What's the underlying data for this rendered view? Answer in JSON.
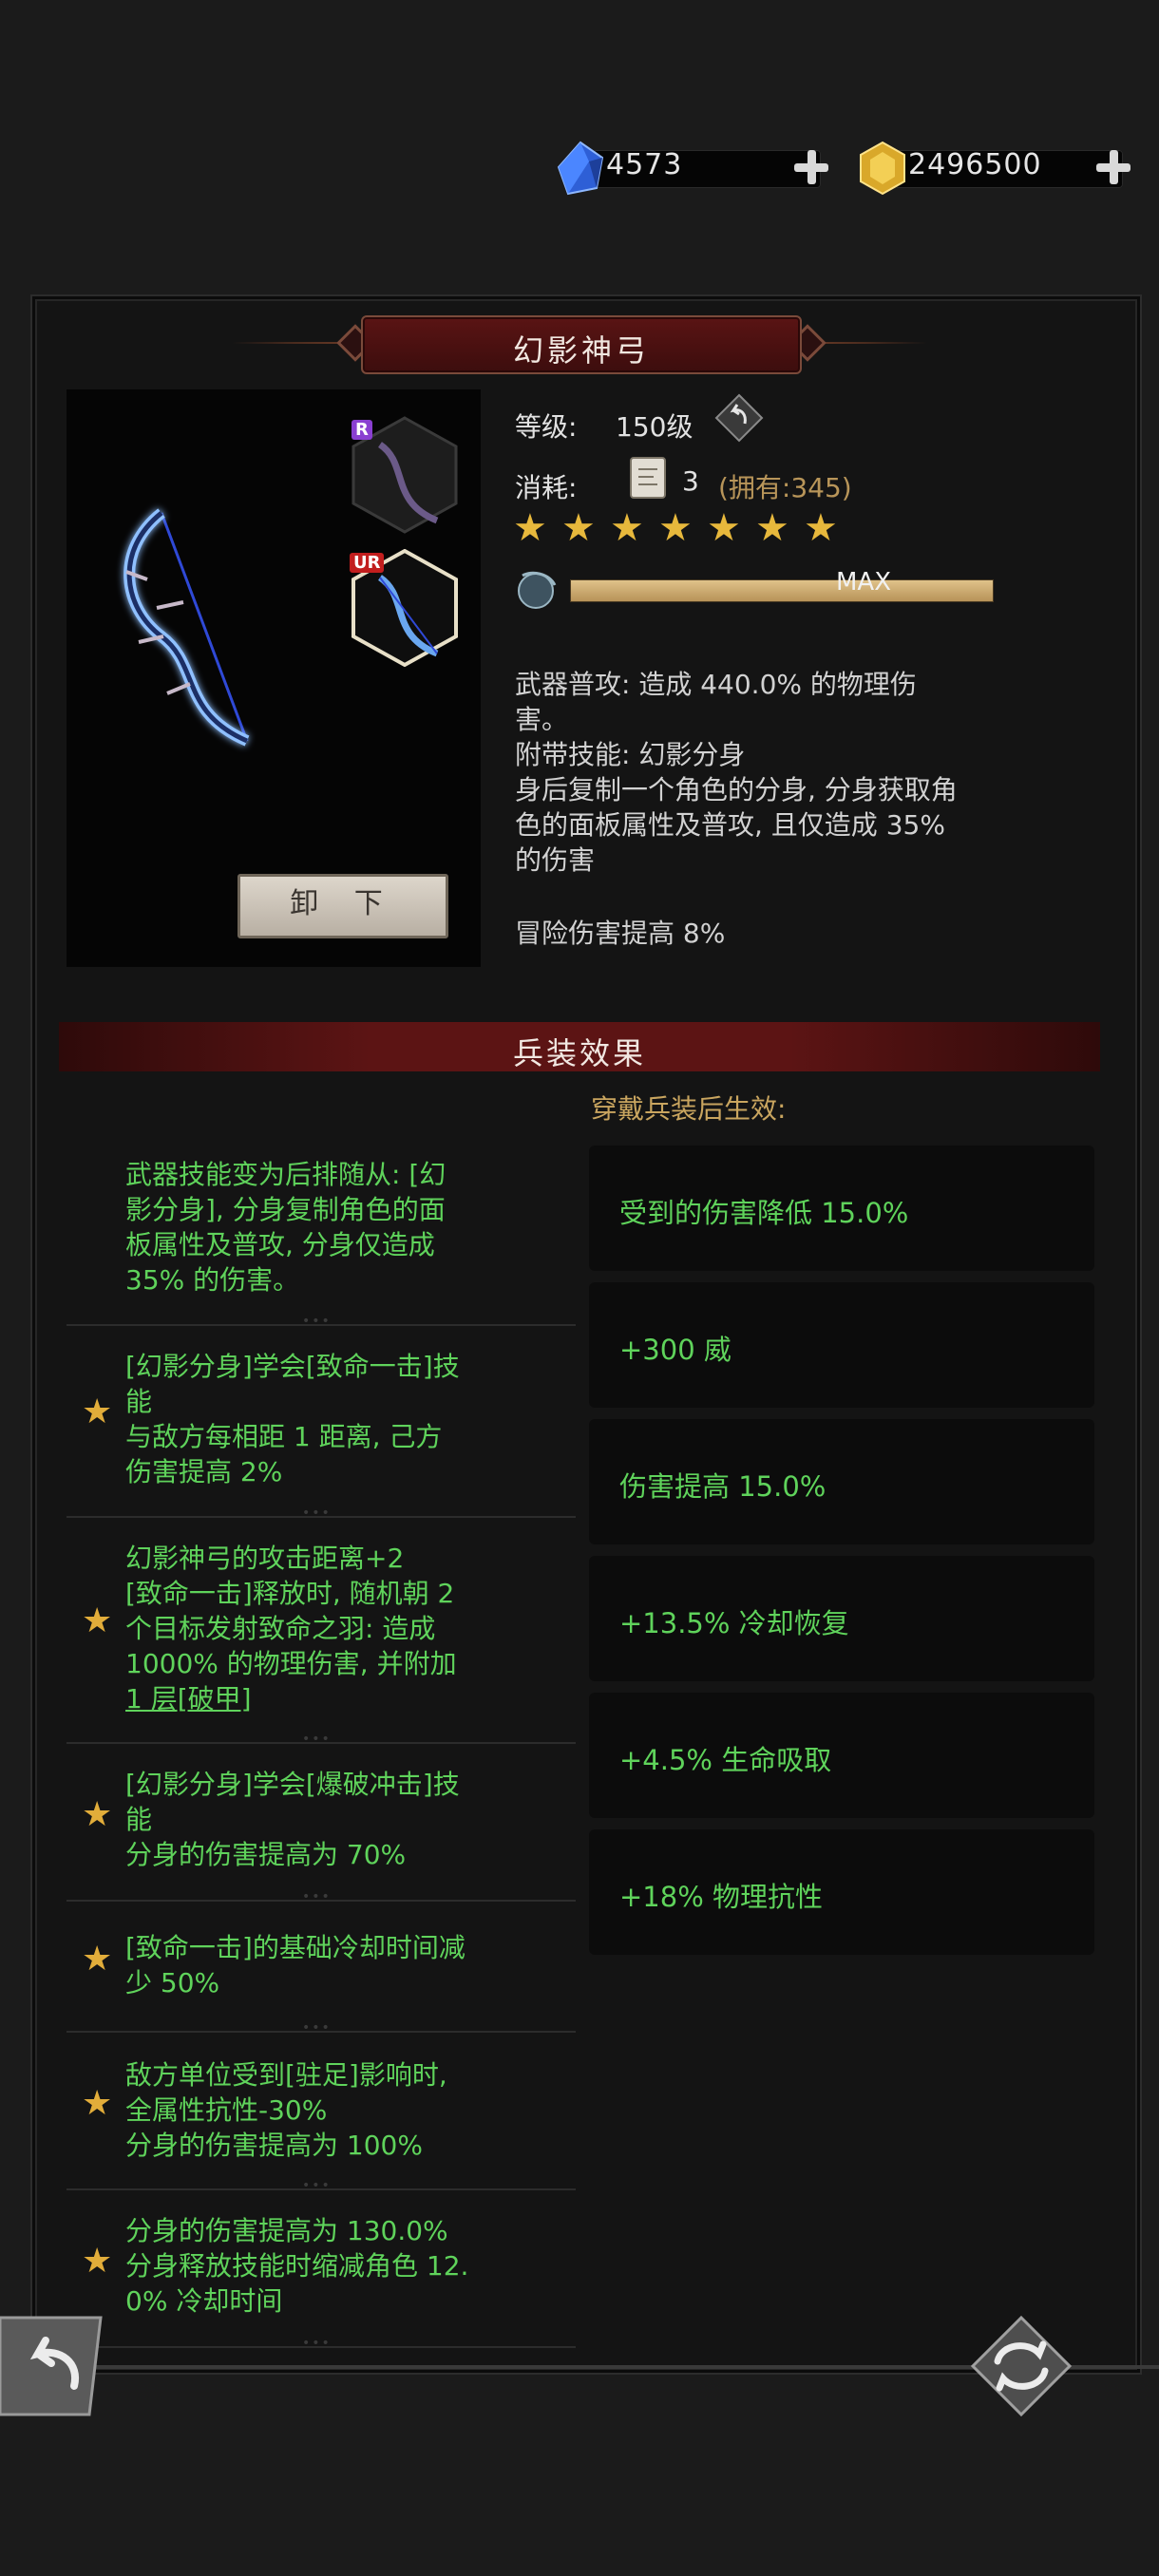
{
  "currency": {
    "gems": {
      "icon": "blue-gem-icon",
      "value": "4573"
    },
    "gold": {
      "icon": "gold-coin-icon",
      "value": "2496500"
    }
  },
  "weapon": {
    "name": "幻影神弓",
    "variants": [
      {
        "rank": "R",
        "rank_color": "#8a3fd1"
      },
      {
        "rank": "UR",
        "rank_color": "#c21e1e"
      }
    ],
    "unequip_label": "卸 下"
  },
  "stats": {
    "level_label": "等级:",
    "level_value": "150级",
    "cost_label": "消耗:",
    "cost_value": "3",
    "owned_text": "(拥有:345)",
    "star_count": 7,
    "progress_text": "MAX",
    "progress_fraction": 1.0
  },
  "description": {
    "line1": "武器普攻: 造成 440.0% 的物理伤",
    "line2": "害。",
    "line3": "附带技能: 幻影分身",
    "line4": "身后复制一个角色的分身, 分身获取角",
    "line5": "色的面板属性及普攻, 且仅造成 35%",
    "line6": "的伤害",
    "line7": "冒险伤害提高 8%"
  },
  "effects": {
    "title": "兵装效果",
    "active_hint": "穿戴兵装后生效:",
    "left": [
      {
        "lines": [
          "武器技能变为后排随从: [幻",
          "影分身], 分身复制角色的面",
          "板属性及普攻, 分身仅造成",
          "35% 的伤害。"
        ],
        "star": false
      },
      {
        "lines": [
          "[幻影分身]学会[致命一击]技",
          "能",
          "与敌方每相距 1 距离, 己方",
          "伤害提高 2%"
        ],
        "star": true
      },
      {
        "lines": [
          "幻影神弓的攻击距离+2",
          "[致命一击]释放时, 随机朝 2",
          "个目标发射致命之羽: 造成",
          "1000% 的物理伤害, 并附加",
          "1 层[破甲]"
        ],
        "star": true
      },
      {
        "lines": [
          "[幻影分身]学会[爆破冲击]技",
          "能",
          "分身的伤害提高为 70%"
        ],
        "star": true
      },
      {
        "lines": [
          "[致命一击]的基础冷却时间减",
          "少 50%"
        ],
        "star": true
      },
      {
        "lines": [
          "敌方单位受到[驻足]影响时,",
          "全属性抗性-30%",
          "分身的伤害提高为 100%"
        ],
        "star": true
      },
      {
        "lines": [
          "分身的伤害提高为 130.0%",
          "分身释放技能时缩减角色 12.",
          "0% 冷却时间"
        ],
        "star": true
      }
    ],
    "right": [
      "受到的伤害降低 15.0%",
      "+300 威",
      "伤害提高 15.0%",
      "+13.5% 冷却恢复",
      "+4.5% 生命吸取",
      "+18% 物理抗性"
    ]
  }
}
